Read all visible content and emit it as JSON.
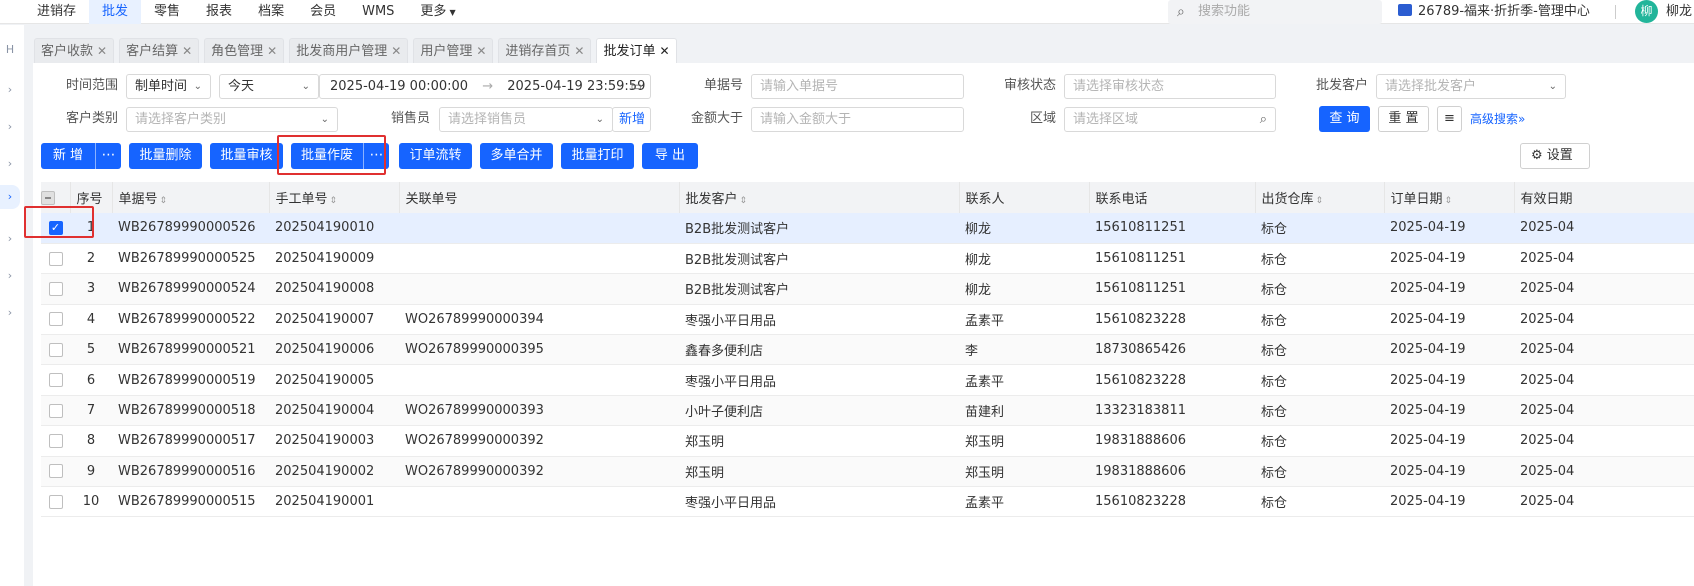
{
  "topnav": {
    "menu": [
      "进销存",
      "批发",
      "零售",
      "报表",
      "档案",
      "会员",
      "WMS",
      "更多"
    ],
    "active_index": 1,
    "search_placeholder": "搜索功能",
    "store_name": "26789-福来·折折季-管理中心",
    "avatar_text": "柳",
    "user_name": "柳龙"
  },
  "tabs": [
    {
      "label": "客户收款"
    },
    {
      "label": "客户结算"
    },
    {
      "label": "角色管理"
    },
    {
      "label": "批发商用户管理"
    },
    {
      "label": "用户管理"
    },
    {
      "label": "进销存首页"
    },
    {
      "label": "批发订单"
    }
  ],
  "filters": {
    "time_range_label": "时间范围",
    "time_type": "制单时间",
    "time_preset": "今天",
    "start_time": "2025-04-19 00:00:00",
    "end_time": "2025-04-19 23:59:59",
    "doc_no_label": "单据号",
    "doc_no_placeholder": "请输入单据号",
    "audit_label": "审核状态",
    "audit_placeholder": "请选择审核状态",
    "customer_label": "批发客户",
    "customer_placeholder": "请选择批发客户",
    "cust_type_label": "客户类别",
    "cust_type_placeholder": "请选择客户类别",
    "sales_label": "销售员",
    "sales_placeholder": "请选择销售员",
    "add_link": "新增",
    "amount_label": "金额大于",
    "amount_placeholder": "请输入金额大于",
    "region_label": "区域",
    "region_placeholder": "请选择区域",
    "query_btn": "查 询",
    "reset_btn": "重 置",
    "advanced": "高级搜索"
  },
  "toolbar": {
    "add": "新 增",
    "batch_delete": "批量删除",
    "batch_audit": "批量审核",
    "batch_void": "批量作废",
    "order_flow": "订单流转",
    "merge": "多单合并",
    "batch_print": "批量打印",
    "export": "导 出",
    "settings": "设置"
  },
  "table": {
    "columns": [
      "序号",
      "单据号",
      "手工单号",
      "关联单号",
      "批发客户",
      "联系人",
      "联系电话",
      "出货仓库",
      "订单日期",
      "有效日期"
    ],
    "rows": [
      {
        "no": "1",
        "doc": "WB26789990000526",
        "manual": "202504190010",
        "rel": "",
        "customer": "B2B批发测试客户",
        "contact": "柳龙",
        "phone": "15610811251",
        "wh": "标仓",
        "date": "2025-04-19",
        "valid": "2025-04"
      },
      {
        "no": "2",
        "doc": "WB26789990000525",
        "manual": "202504190009",
        "rel": "",
        "customer": "B2B批发测试客户",
        "contact": "柳龙",
        "phone": "15610811251",
        "wh": "标仓",
        "date": "2025-04-19",
        "valid": "2025-04"
      },
      {
        "no": "3",
        "doc": "WB26789990000524",
        "manual": "202504190008",
        "rel": "",
        "customer": "B2B批发测试客户",
        "contact": "柳龙",
        "phone": "15610811251",
        "wh": "标仓",
        "date": "2025-04-19",
        "valid": "2025-04"
      },
      {
        "no": "4",
        "doc": "WB26789990000522",
        "manual": "202504190007",
        "rel": "WO26789990000394",
        "customer": "枣强小平日用品",
        "contact": "孟素平",
        "phone": "15610823228",
        "wh": "标仓",
        "date": "2025-04-19",
        "valid": "2025-04"
      },
      {
        "no": "5",
        "doc": "WB26789990000521",
        "manual": "202504190006",
        "rel": "WO26789990000395",
        "customer": "鑫春多便利店",
        "contact": "李",
        "phone": "18730865426",
        "wh": "标仓",
        "date": "2025-04-19",
        "valid": "2025-04"
      },
      {
        "no": "6",
        "doc": "WB26789990000519",
        "manual": "202504190005",
        "rel": "",
        "customer": "枣强小平日用品",
        "contact": "孟素平",
        "phone": "15610823228",
        "wh": "标仓",
        "date": "2025-04-19",
        "valid": "2025-04"
      },
      {
        "no": "7",
        "doc": "WB26789990000518",
        "manual": "202504190004",
        "rel": "WO26789990000393",
        "customer": "小叶子便利店",
        "contact": "苗建利",
        "phone": "13323183811",
        "wh": "标仓",
        "date": "2025-04-19",
        "valid": "2025-04"
      },
      {
        "no": "8",
        "doc": "WB26789990000517",
        "manual": "202504190003",
        "rel": "WO26789990000392",
        "customer": "郑玉明",
        "contact": "郑玉明",
        "phone": "19831888606",
        "wh": "标仓",
        "date": "2025-04-19",
        "valid": "2025-04"
      },
      {
        "no": "9",
        "doc": "WB26789990000516",
        "manual": "202504190002",
        "rel": "WO26789990000392",
        "customer": "郑玉明",
        "contact": "郑玉明",
        "phone": "19831888606",
        "wh": "标仓",
        "date": "2025-04-19",
        "valid": "2025-04"
      },
      {
        "no": "10",
        "doc": "WB26789990000515",
        "manual": "202504190001",
        "rel": "",
        "customer": "枣强小平日用品",
        "contact": "孟素平",
        "phone": "15610823228",
        "wh": "标仓",
        "date": "2025-04-19",
        "valid": "2025-04"
      }
    ]
  },
  "colors": {
    "primary": "#1664ff",
    "highlight": "#e03030"
  }
}
